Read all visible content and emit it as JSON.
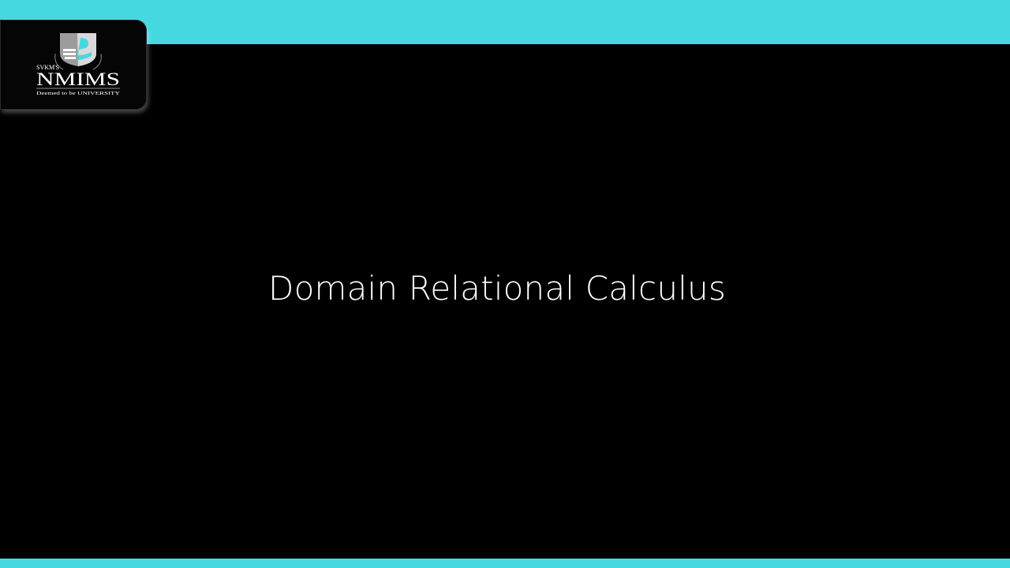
{
  "slide": {
    "title": "Domain Relational Calculus"
  },
  "logo": {
    "prefix": "SVKM'S",
    "name": "NMIMS",
    "tagline": "Deemed to be UNIVERSITY"
  },
  "colors": {
    "accent_band": "#46d8e0",
    "background": "#000000",
    "title_text": "#ffffff",
    "shield_gray": "#9c9c9c",
    "shield_cyan": "#46d8e0"
  }
}
